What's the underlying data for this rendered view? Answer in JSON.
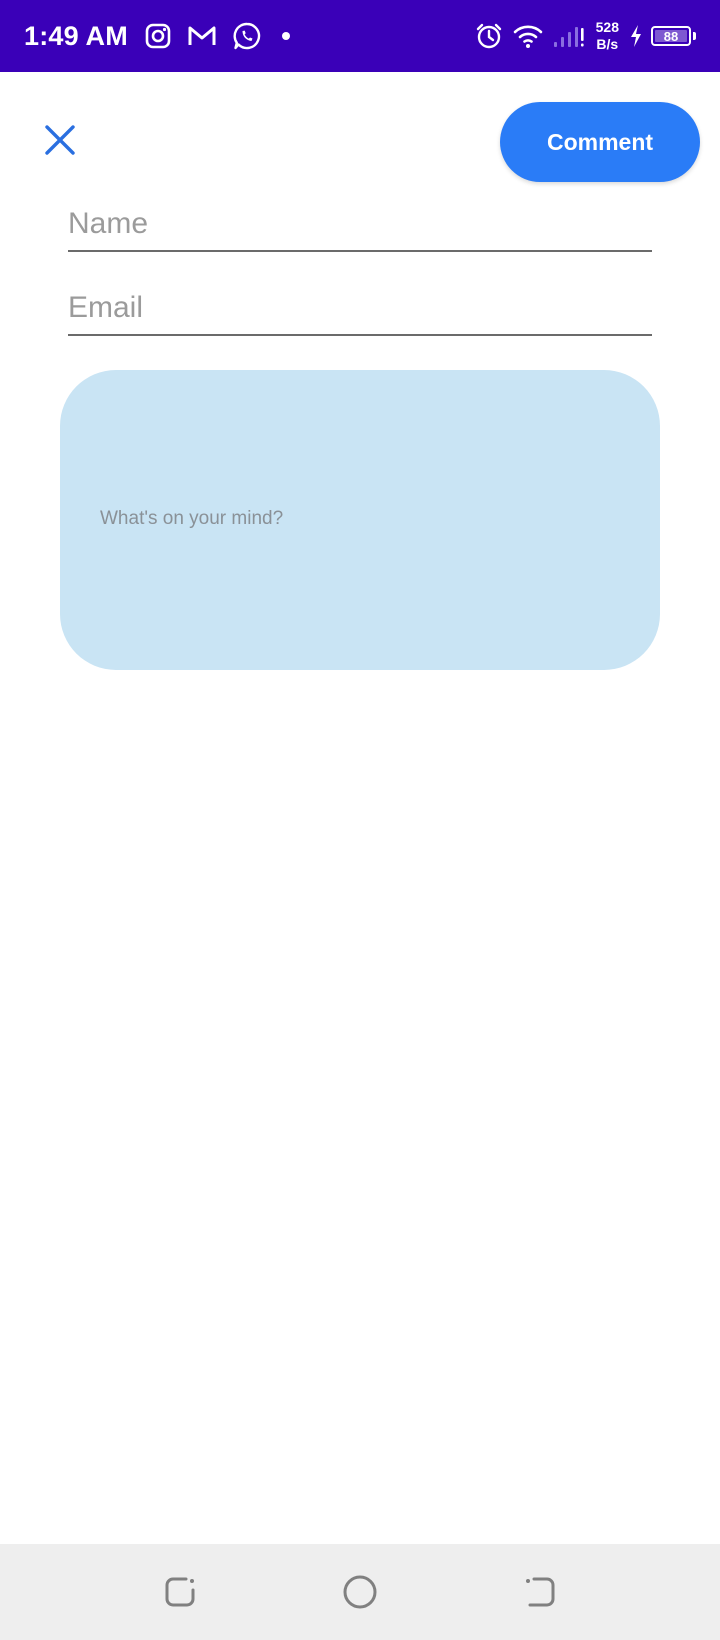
{
  "status_bar": {
    "time": "1:49 AM",
    "notification_icons": [
      "instagram-icon",
      "gmail-icon",
      "whatsapp-icon",
      "dot-icon"
    ],
    "right_icons": [
      "alarm-icon",
      "wifi-icon",
      "signal-icon",
      "charging-icon"
    ],
    "net_speed_value": "528",
    "net_speed_unit": "B/s",
    "battery_level": "88",
    "background_color": "#3a00b8"
  },
  "header": {
    "close_icon": "close-icon",
    "comment_button_label": "Comment",
    "accent_color": "#2a7cf7"
  },
  "form": {
    "name_placeholder": "Name",
    "name_value": "",
    "email_placeholder": "Email",
    "email_value": "",
    "message_placeholder": "What's on your mind?",
    "message_value": "",
    "message_box_color": "#c9e4f4"
  },
  "nav_bar": {
    "buttons": [
      "recent-apps-icon",
      "home-icon",
      "back-icon"
    ]
  }
}
